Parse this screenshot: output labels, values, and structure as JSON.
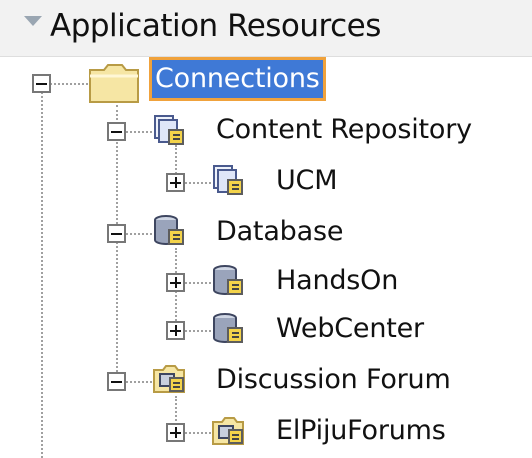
{
  "panel": {
    "title": "Application Resources"
  },
  "tree": {
    "connections": {
      "label": "Connections",
      "selected": true,
      "expanded": true,
      "icon": "folder-icon"
    },
    "content_repository": {
      "label": "Content Repository",
      "expanded": true,
      "icon": "content-repository-connection-icon",
      "children": [
        {
          "label": "UCM",
          "expanded": false,
          "icon": "content-repository-connection-icon"
        }
      ]
    },
    "database": {
      "label": "Database",
      "expanded": true,
      "icon": "database-connection-icon",
      "children": [
        {
          "label": "HandsOn",
          "expanded": false,
          "icon": "database-connection-icon"
        },
        {
          "label": "WebCenter",
          "expanded": false,
          "icon": "database-connection-icon"
        }
      ]
    },
    "discussion_forum": {
      "label": "Discussion Forum",
      "expanded": true,
      "icon": "discussion-forum-connection-icon",
      "children": [
        {
          "label": "ElPijuForums",
          "expanded": false,
          "icon": "discussion-forum-connection-icon"
        }
      ]
    }
  },
  "colors": {
    "selection_background": "#3f79d6",
    "selection_border": "#f0a23c",
    "header_background": "#f2f2f2",
    "folder_yellow": "#f6e6a4"
  }
}
